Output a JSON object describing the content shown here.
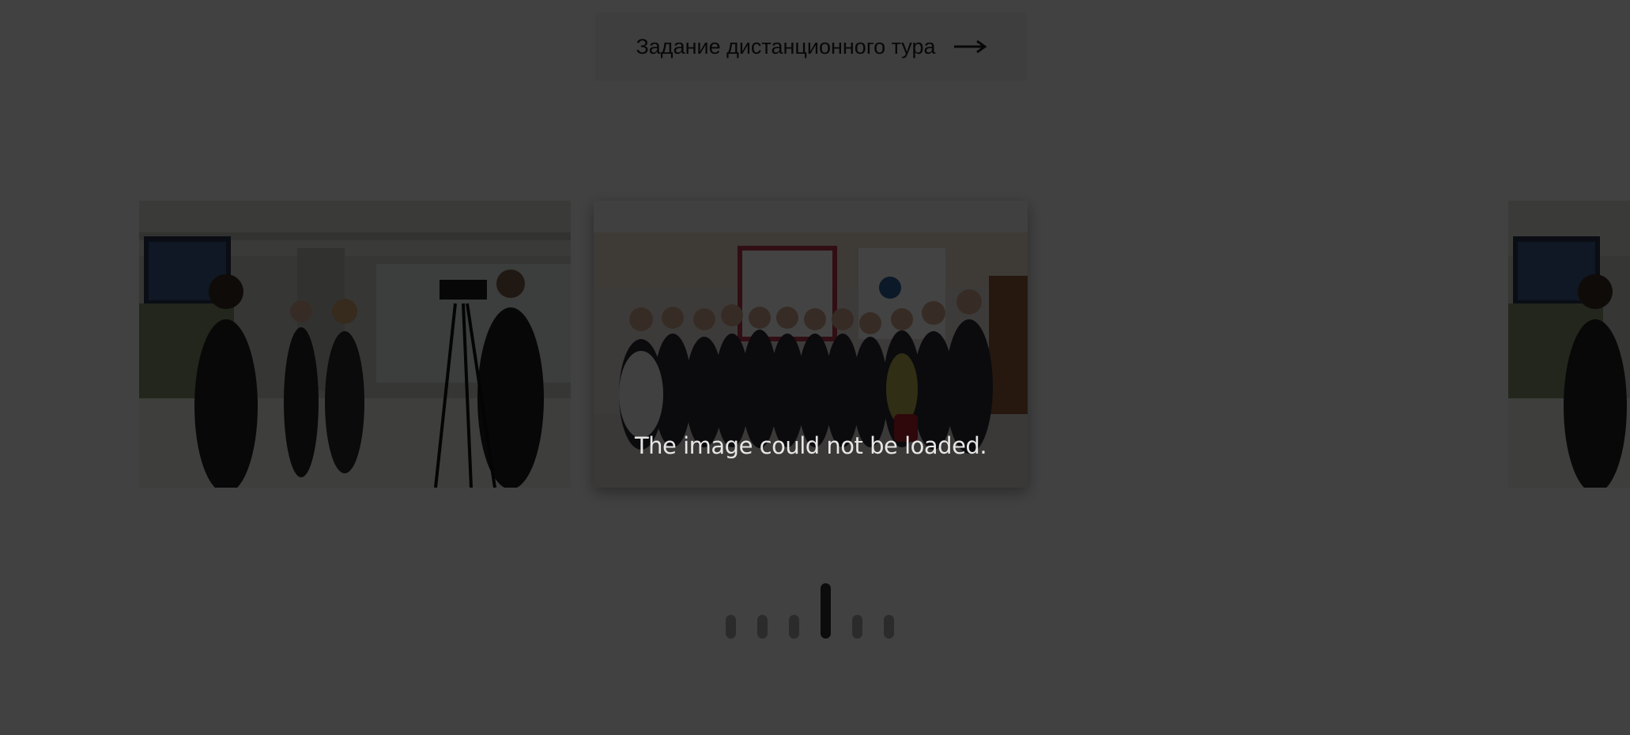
{
  "task_button": {
    "label": "Задание дистанционного тура",
    "icon": "arrow-right-icon"
  },
  "gallery": {
    "slides": [
      {
        "name": "slide-interview",
        "position": "left"
      },
      {
        "name": "slide-group-photo",
        "position": "center"
      },
      {
        "name": "slide-interview-next",
        "position": "right"
      }
    ],
    "error_message": "The image could not be loaded.",
    "pager": {
      "count": 6,
      "active_index": 3
    }
  },
  "colors": {
    "page_background": "#f4f4f4",
    "overlay": "rgba(0,0,0,0.735)",
    "button_background": "#e8e8e8",
    "pager_dot": "#2b2b2b",
    "pager_active": "#0c0c0c"
  }
}
